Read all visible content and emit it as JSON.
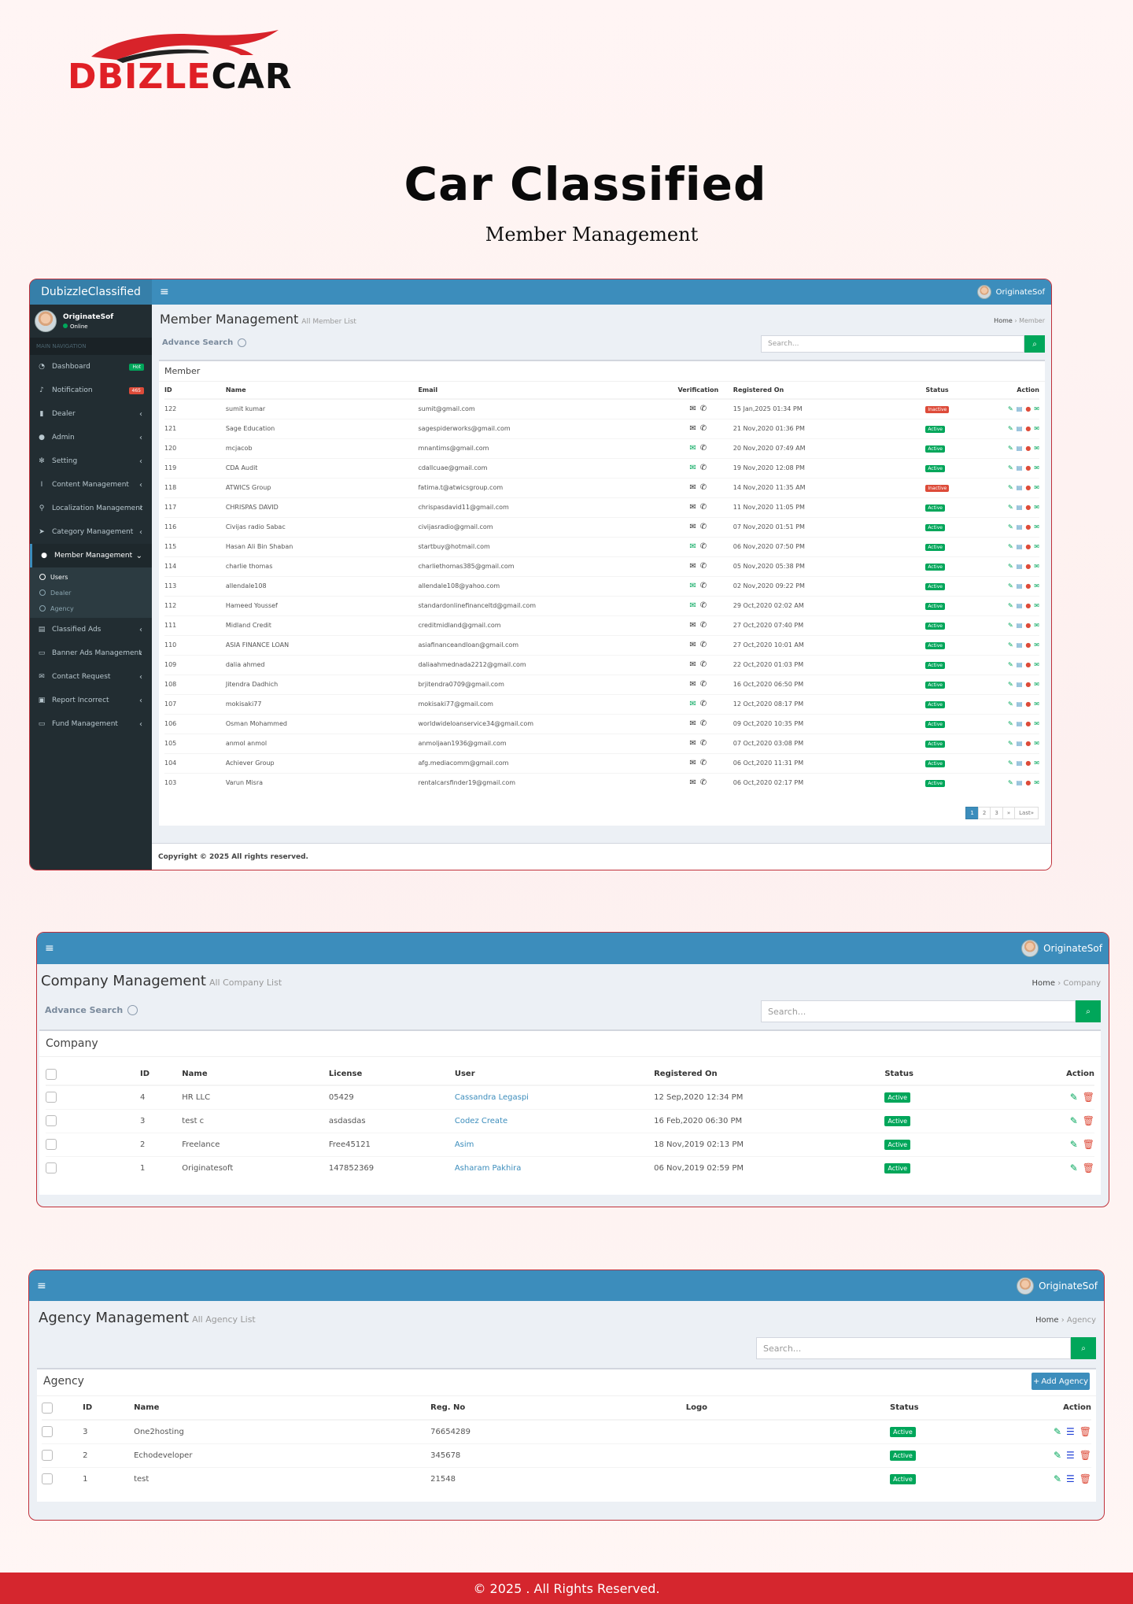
{
  "brand": {
    "logo_text_red": "DBIZLE",
    "logo_text_black": "CAR",
    "red": "#e02026"
  },
  "hero": {
    "title": "Car Classified",
    "subtitle": "Member Management"
  },
  "admin": {
    "brand": "DubizzleClassified",
    "user": {
      "name": "OriginateSof",
      "status": "Online"
    },
    "nav_header": "MAIN NAVIGATION",
    "menu": [
      {
        "label": "Dashboard",
        "icon": "dashboard-icon",
        "badge": "Hot",
        "badge_color": "#00a65a"
      },
      {
        "label": "Notification",
        "icon": "bell-icon",
        "badge": "465",
        "badge_color": "#dd4b39"
      },
      {
        "label": "Dealer",
        "icon": "chart-icon"
      },
      {
        "label": "Admin",
        "icon": "user-icon"
      },
      {
        "label": "Setting",
        "icon": "gear-icon"
      },
      {
        "label": "Content Management",
        "icon": "text-cursor-icon"
      },
      {
        "label": "Localization Management",
        "icon": "map-pin-icon"
      },
      {
        "label": "Category Management",
        "icon": "pointer-icon"
      },
      {
        "label": "Member Management",
        "icon": "users-icon",
        "active": true
      },
      {
        "label": "Classified Ads",
        "icon": "list-icon"
      },
      {
        "label": "Banner Ads Management",
        "icon": "banner-icon"
      },
      {
        "label": "Contact Request",
        "icon": "envelope-icon"
      },
      {
        "label": "Report Incorrect",
        "icon": "report-icon"
      },
      {
        "label": "Fund Management",
        "icon": "money-icon"
      }
    ],
    "submenu": [
      "Users",
      "Dealer",
      "Agency"
    ],
    "copyright": "Copyright © 2025 All rights reserved."
  },
  "member": {
    "title": "Member Management",
    "subtitle": "All Member List",
    "crumb_home": "Home",
    "crumb_current": "Member",
    "advance_search": "Advance Search",
    "search_placeholder": "Search...",
    "box_title": "Member",
    "columns": [
      "ID",
      "Name",
      "Email",
      "Verification",
      "Registered On",
      "Status",
      "Action"
    ],
    "rows": [
      {
        "id": "122",
        "name": "sumit kumar",
        "email": "sumit@gmail.com",
        "verified": false,
        "date": "15 Jan,2025 01:34 PM",
        "status": "Inactive"
      },
      {
        "id": "121",
        "name": "Sage Education",
        "email": "sagespiderworks@gmail.com",
        "verified": false,
        "date": "21 Nov,2020 01:36 PM",
        "status": "Active"
      },
      {
        "id": "120",
        "name": "mcjacob",
        "email": "mnantims@gmail.com",
        "verified": true,
        "date": "20 Nov,2020 07:49 AM",
        "status": "Active"
      },
      {
        "id": "119",
        "name": "CDA Audit",
        "email": "cdallcuae@gmail.com",
        "verified": true,
        "date": "19 Nov,2020 12:08 PM",
        "status": "Active"
      },
      {
        "id": "118",
        "name": "ATWICS Group",
        "email": "fatima.t@atwicsgroup.com",
        "verified": false,
        "date": "14 Nov,2020 11:35 AM",
        "status": "Inactive"
      },
      {
        "id": "117",
        "name": "CHRISPAS DAVID",
        "email": "chrispasdavid11@gmail.com",
        "verified": false,
        "date": "11 Nov,2020 11:05 PM",
        "status": "Active"
      },
      {
        "id": "116",
        "name": "Civijas radio Sabac",
        "email": "civijasradio@gmail.com",
        "verified": false,
        "date": "07 Nov,2020 01:51 PM",
        "status": "Active"
      },
      {
        "id": "115",
        "name": "Hasan Ali Bin Shaban",
        "email": "startbuy@hotmail.com",
        "verified": true,
        "date": "06 Nov,2020 07:50 PM",
        "status": "Active"
      },
      {
        "id": "114",
        "name": "charlie thomas",
        "email": "charliethomas385@gmail.com",
        "verified": false,
        "date": "05 Nov,2020 05:38 PM",
        "status": "Active"
      },
      {
        "id": "113",
        "name": "allendale108",
        "email": "allendale108@yahoo.com",
        "verified": true,
        "date": "02 Nov,2020 09:22 PM",
        "status": "Active"
      },
      {
        "id": "112",
        "name": "Hameed Youssef",
        "email": "standardonlinefinanceltd@gmail.com",
        "verified": true,
        "date": "29 Oct,2020 02:02 AM",
        "status": "Active"
      },
      {
        "id": "111",
        "name": "Midland Credit",
        "email": "creditmidland@gmail.com",
        "verified": false,
        "date": "27 Oct,2020 07:40 PM",
        "status": "Active"
      },
      {
        "id": "110",
        "name": "ASIA FINANCE LOAN",
        "email": "asiafinanceandloan@gmail.com",
        "verified": false,
        "date": "27 Oct,2020 10:01 AM",
        "status": "Active"
      },
      {
        "id": "109",
        "name": "dalia ahmed",
        "email": "daliaahmednada2212@gmail.com",
        "verified": false,
        "date": "22 Oct,2020 01:03 PM",
        "status": "Active"
      },
      {
        "id": "108",
        "name": "Jitendra Dadhich",
        "email": "brjitendra0709@gmail.com",
        "verified": false,
        "date": "16 Oct,2020 06:50 PM",
        "status": "Active"
      },
      {
        "id": "107",
        "name": "mokisaki77",
        "email": "mokisaki77@gmail.com",
        "verified": true,
        "date": "12 Oct,2020 08:17 PM",
        "status": "Active"
      },
      {
        "id": "106",
        "name": "Osman Mohammed",
        "email": "worldwideloanservice34@gmail.com",
        "verified": false,
        "date": "09 Oct,2020 10:35 PM",
        "status": "Active"
      },
      {
        "id": "105",
        "name": "anmol anmol",
        "email": "anmoljaan1936@gmail.com",
        "verified": false,
        "date": "07 Oct,2020 03:08 PM",
        "status": "Active"
      },
      {
        "id": "104",
        "name": "Achiever Group",
        "email": "afg.mediacomm@gmail.com",
        "verified": false,
        "date": "06 Oct,2020 11:31 PM",
        "status": "Active"
      },
      {
        "id": "103",
        "name": "Varun Misra",
        "email": "rentalcarsfinder19@gmail.com",
        "verified": false,
        "date": "06 Oct,2020 02:17 PM",
        "status": "Active"
      }
    ],
    "pages": [
      "1",
      "2",
      "3",
      "»",
      "Last»"
    ]
  },
  "company": {
    "title": "Company Management",
    "subtitle": "All Company List",
    "crumb_home": "Home",
    "crumb_current": "Company",
    "advance_search": "Advance Search",
    "search_placeholder": "Search...",
    "box_title": "Company",
    "columns": [
      "ID",
      "Name",
      "License",
      "User",
      "Registered On",
      "Status",
      "Action"
    ],
    "rows": [
      {
        "id": "4",
        "name": "HR LLC",
        "license": "05429",
        "user": "Cassandra Legaspi",
        "date": "12 Sep,2020 12:34 PM",
        "status": "Active"
      },
      {
        "id": "3",
        "name": "test c",
        "license": "asdasdas",
        "user": "Codez Create",
        "date": "16 Feb,2020 06:30 PM",
        "status": "Active"
      },
      {
        "id": "2",
        "name": "Freelance",
        "license": "Free45121",
        "user": "Asim",
        "date": "18 Nov,2019 02:13 PM",
        "status": "Active"
      },
      {
        "id": "1",
        "name": "Originatesoft",
        "license": "147852369",
        "user": "Asharam Pakhira",
        "date": "06 Nov,2019 02:59 PM",
        "status": "Active"
      }
    ]
  },
  "agency": {
    "title": "Agency Management",
    "subtitle": "All Agency List",
    "crumb_home": "Home",
    "crumb_current": "Agency",
    "search_placeholder": "Search...",
    "box_title": "Agency",
    "add_button": "Add Agency",
    "columns": [
      "ID",
      "Name",
      "Reg. No",
      "Logo",
      "Status",
      "Action"
    ],
    "rows": [
      {
        "id": "3",
        "name": "One2hosting",
        "reg": "76654289",
        "status": "Active"
      },
      {
        "id": "2",
        "name": "Echodeveloper",
        "reg": "345678",
        "status": "Active"
      },
      {
        "id": "1",
        "name": "test",
        "reg": "21548",
        "status": "Active"
      }
    ]
  },
  "footer": {
    "text": "© 2025 . All Rights Reserved."
  }
}
